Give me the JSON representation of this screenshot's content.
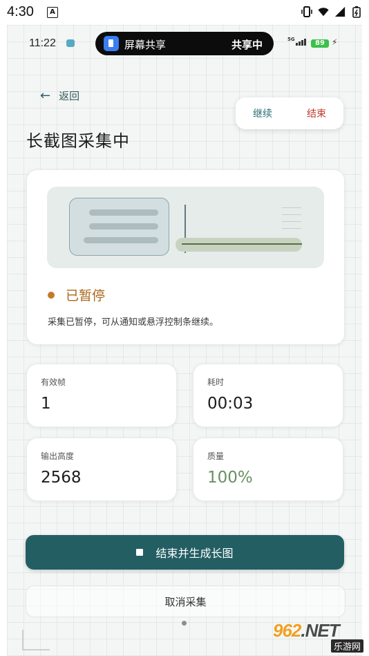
{
  "system_bar": {
    "time": "4:30",
    "notif_icon": "A"
  },
  "device_status": {
    "time": "11:22",
    "share_label": "屏幕共享",
    "share_state": "共享中",
    "network": "5G",
    "battery": "89"
  },
  "header": {
    "back_label": "返回",
    "title": "长截图采集中"
  },
  "floating_controls": {
    "continue_label": "继续",
    "end_label": "结束"
  },
  "status": {
    "label": "已暂停",
    "description": "采集已暂停，可从通知或悬浮控制条继续。",
    "color": "#c47a29"
  },
  "stats": [
    {
      "label": "有效帧",
      "value": "1"
    },
    {
      "label": "耗时",
      "value": "00:03"
    },
    {
      "label": "输出高度",
      "value": "2568"
    },
    {
      "label": "质量",
      "value": "100%"
    }
  ],
  "actions": {
    "primary_label": "结束并生成长图",
    "secondary_label": "取消采集"
  },
  "watermark": {
    "brand": "962",
    "domain": ".NET",
    "subtitle": "乐游网"
  },
  "colors": {
    "accent": "#235e63",
    "danger": "#c0392b",
    "paused": "#c47a29",
    "quality": "#6a8f63"
  }
}
